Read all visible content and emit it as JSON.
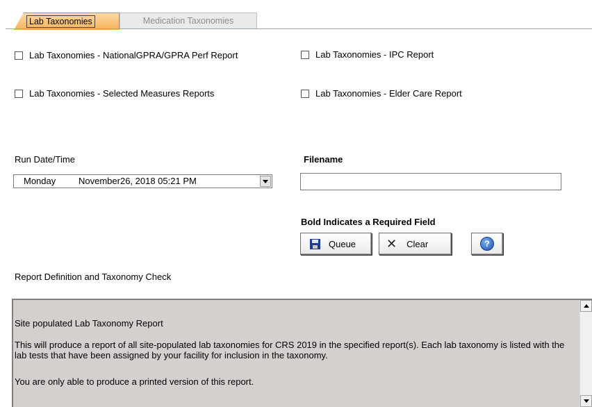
{
  "tabs": [
    {
      "label": "Lab Taxonomies",
      "active": true
    },
    {
      "label": "Medication Taxonomies",
      "active": false
    }
  ],
  "reports": [
    {
      "label": "Lab Taxonomies - NationalGPRA/GPRA Perf Report",
      "checked": false
    },
    {
      "label": "Lab Taxonomies - IPC Report",
      "checked": false
    },
    {
      "label": "Lab Taxonomies - Selected Measures Reports",
      "checked": false
    },
    {
      "label": "Lab Taxonomies - Elder Care Report",
      "checked": false
    }
  ],
  "run_date": {
    "label": "Run Date/Time",
    "day": "Monday",
    "value": "November26, 2018  05:21 PM"
  },
  "filename": {
    "label": "Filename",
    "value": ""
  },
  "required_note": "Bold Indicates a Required Field",
  "buttons": {
    "queue": "Queue",
    "clear": "Clear",
    "help_symbol": "?"
  },
  "report_definition": {
    "label": "Report Definition and Taxonomy Check",
    "title": "Site populated Lab Taxonomy Report",
    "paragraph": "This will produce a report of all site-populated lab taxonomies for CRS 2019 in the specified report(s).  Each lab taxonomy is listed with the lab tests that have been assigned by your facility for inclusion in the taxonomy.",
    "note": "You are only able to produce a printed version of this report."
  },
  "icons": {
    "queue": "floppy-disk-icon",
    "clear": "x-icon",
    "help": "help-icon"
  },
  "colors": {
    "active_tab": "#f6b45a",
    "panel_background": "#d3d0cd",
    "help_icon": "#1a4fb5"
  }
}
